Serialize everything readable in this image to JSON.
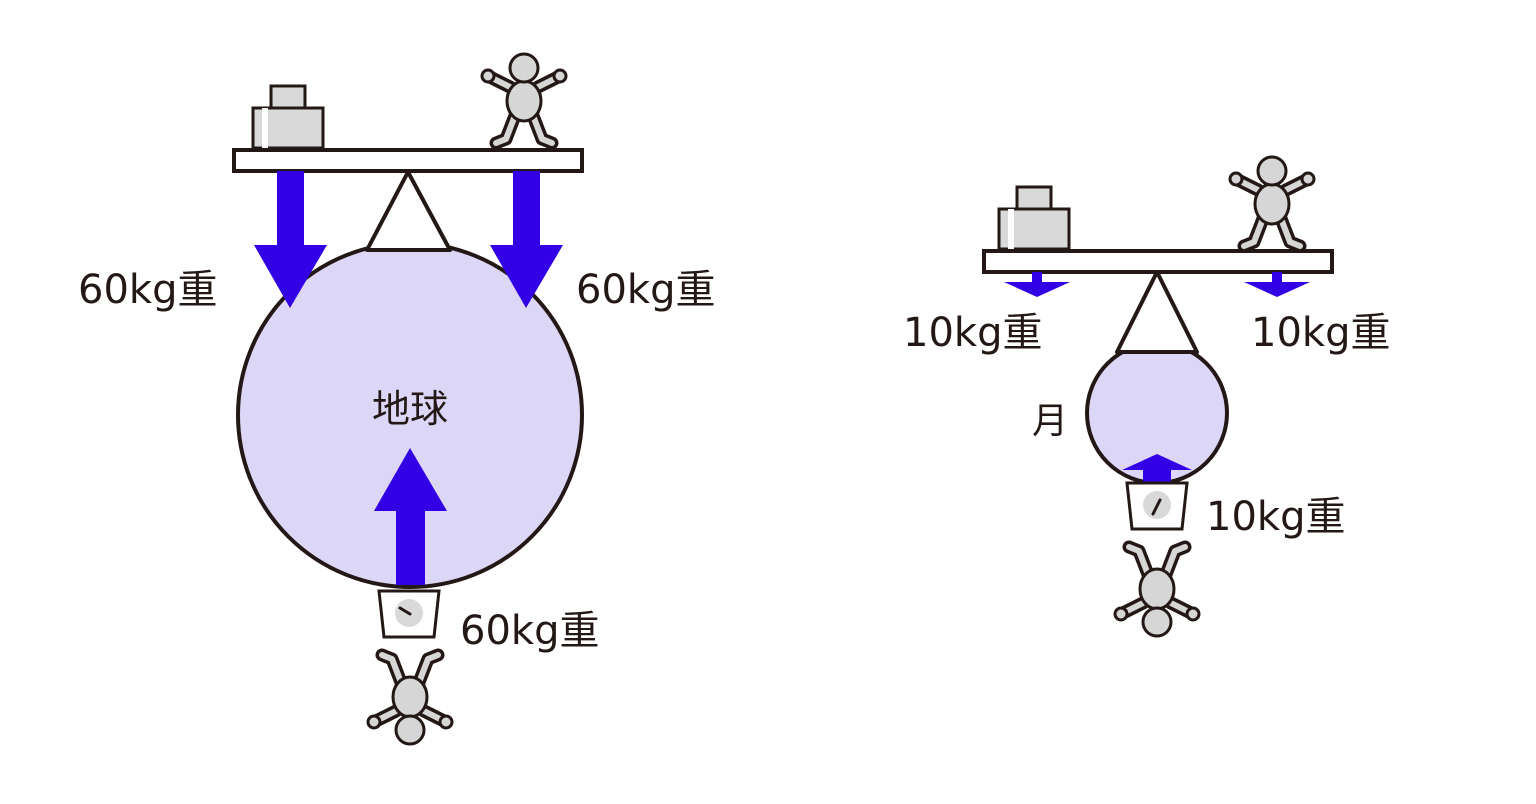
{
  "colors": {
    "arrow": "#3300e6",
    "planet_fill": "#dcd6f7",
    "outline": "#231815",
    "figure_fill": "#d6d6d6",
    "weight_fill": "#d9d9d9"
  },
  "earth": {
    "name": "地球",
    "left_force": "60kg重",
    "right_force": "60kg重",
    "scale_reading": "60kg重"
  },
  "moon": {
    "name": "月",
    "left_force": "10kg重",
    "right_force": "10kg重",
    "scale_reading": "10kg重"
  }
}
